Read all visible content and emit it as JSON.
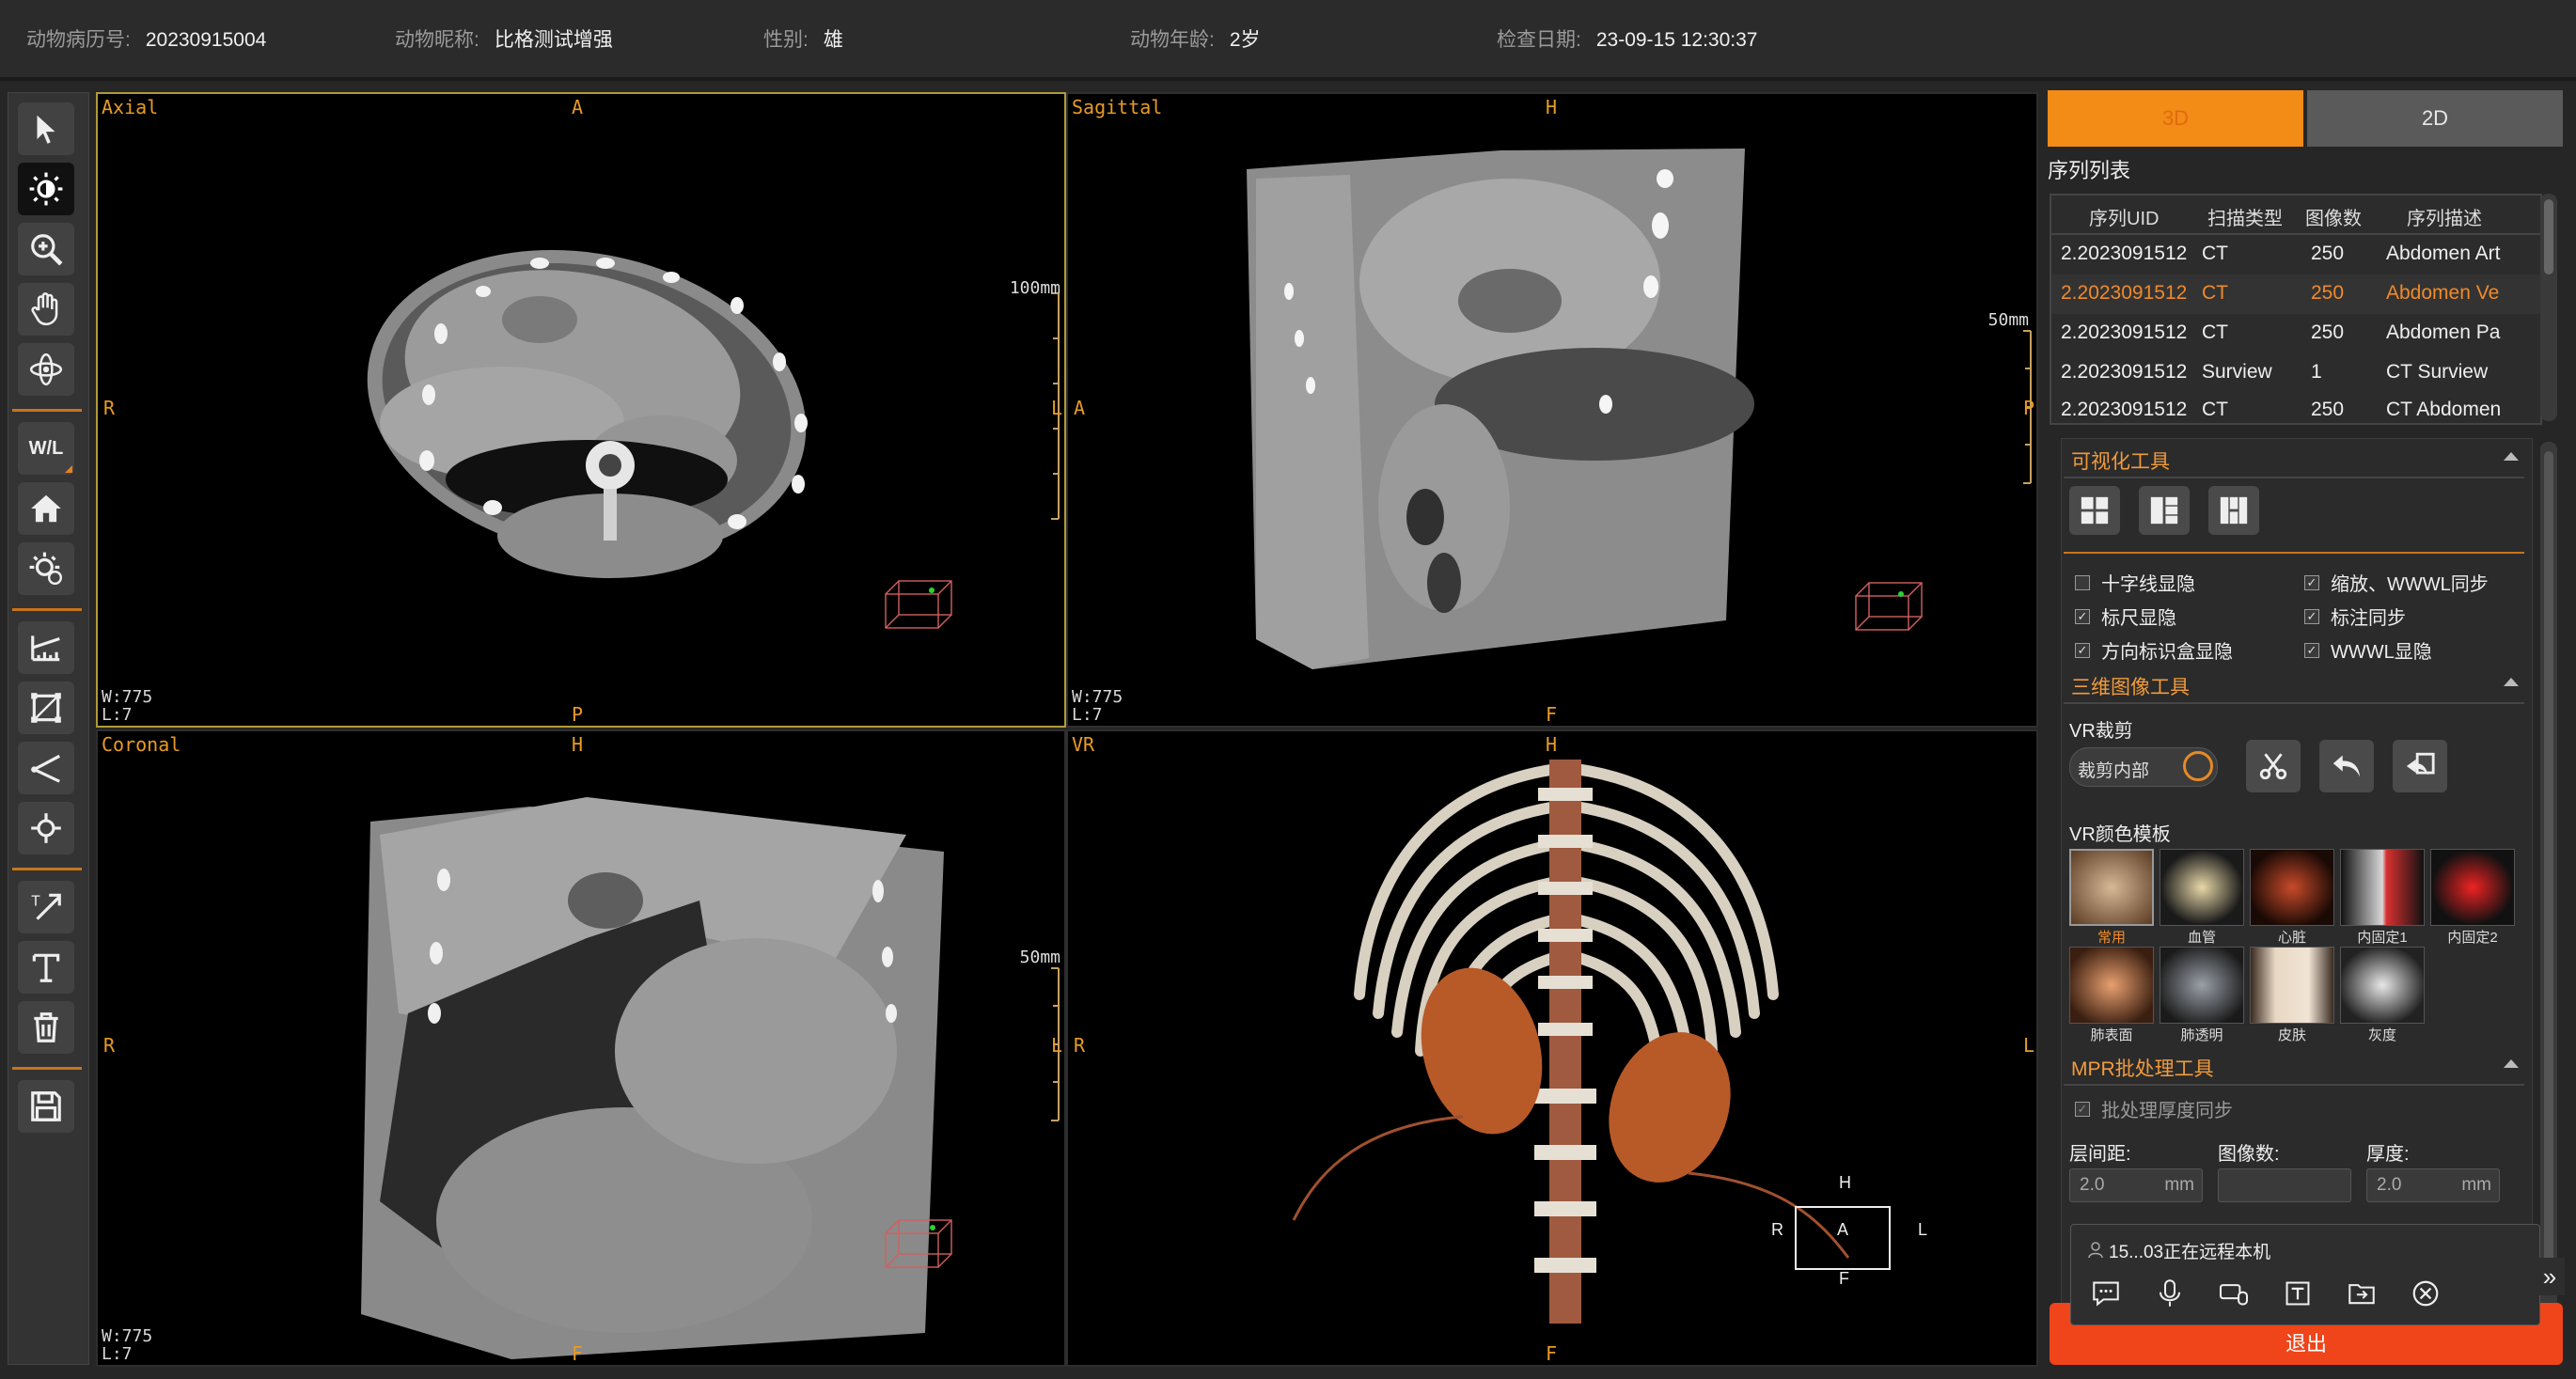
{
  "header": {
    "record_label": "动物病历号:",
    "record_value": "20230915004",
    "nickname_label": "动物昵称:",
    "nickname_value": "比格测试增强",
    "gender_label": "性别:",
    "gender_value": "雄",
    "age_label": "动物年龄:",
    "age_value": "2岁",
    "date_label": "检查日期:",
    "date_value": "23-09-15 12:30:37"
  },
  "toolbar": {
    "tools": [
      "pointer-icon",
      "brightness-icon",
      "zoom-icon",
      "pan-hand-icon",
      "rotate-icon",
      "window-level-icon",
      "home-icon",
      "auto-window-icon",
      "ruler-icon",
      "roi-rectangle-icon",
      "angle-icon",
      "point-probe-icon",
      "arrow-annotation-icon",
      "text-icon",
      "trash-icon",
      "save-icon"
    ],
    "wl_label": "W/L"
  },
  "viewports": {
    "axial": {
      "name": "Axial",
      "top": "A",
      "bottom": "P",
      "left": "R",
      "right": "L",
      "scale": "100mm",
      "w": "W:775",
      "l": "L:7"
    },
    "sagittal": {
      "name": "Sagittal",
      "top": "H",
      "bottom": "F",
      "left": "A",
      "right": "P",
      "scale": "50mm",
      "w": "W:775",
      "l": "L:7"
    },
    "coronal": {
      "name": "Coronal",
      "top": "H",
      "bottom": "F",
      "left": "R",
      "right": "L",
      "scale": "50mm",
      "w": "W:775",
      "l": "L:7"
    },
    "vr": {
      "name": "VR",
      "top": "H",
      "bottom": "F",
      "left": "R",
      "right": "L",
      "cube_h": "H",
      "cube_a": "A",
      "cube_f": "F",
      "cube_r": "R",
      "cube_l": "L"
    }
  },
  "right_panel": {
    "tab_3d": "3D",
    "tab_2d": "2D",
    "series_title": "序列列表",
    "series_headers": [
      "序列UID",
      "扫描类型",
      "图像数",
      "序列描述"
    ],
    "series_rows": [
      {
        "uid": "2.2023091512",
        "type": "CT",
        "count": "250",
        "desc": "Abdomen Art"
      },
      {
        "uid": "2.2023091512",
        "type": "CT",
        "count": "250",
        "desc": "Abdomen Ve"
      },
      {
        "uid": "2.2023091512",
        "type": "CT",
        "count": "250",
        "desc": "Abdomen Pa"
      },
      {
        "uid": "2.2023091512",
        "type": "Surview",
        "count": "1",
        "desc": "CT Surview"
      },
      {
        "uid": "2.2023091512",
        "type": "CT",
        "count": "250",
        "desc": "CT Abdomen"
      }
    ],
    "selected_row": 1,
    "vis_title": "可视化工具",
    "checks": [
      {
        "label": "十字线显隐",
        "checked": false
      },
      {
        "label": "缩放、WWWL同步",
        "checked": true
      },
      {
        "label": "标尺显隐",
        "checked": true
      },
      {
        "label": "标注同步",
        "checked": true
      },
      {
        "label": "方向标识盒显隐",
        "checked": true
      },
      {
        "label": "WWWL显隐",
        "checked": true
      }
    ],
    "three_d_title": "三维图像工具",
    "vr_crop_label": "VR裁剪",
    "crop_toggle": "裁剪内部",
    "color_title": "VR颜色模板",
    "templates": [
      "常用",
      "血管",
      "心脏",
      "内固定1",
      "内固定2",
      "肺表面",
      "肺透明",
      "皮肤",
      "灰度"
    ],
    "mpr_title": "MPR批处理工具",
    "batch_sync": "批处理厚度同步",
    "spacing_label": "层间距:",
    "count_label": "图像数:",
    "thickness_label": "厚度:",
    "spacing_value": "2.0",
    "thickness_value": "2.0",
    "unit": "mm"
  },
  "remote": {
    "text": "15...03正在远程本机"
  },
  "exit_label": "退出",
  "colors": {
    "accent": "#f38b17",
    "exit": "#f0441a",
    "orient": "#e89b24"
  }
}
